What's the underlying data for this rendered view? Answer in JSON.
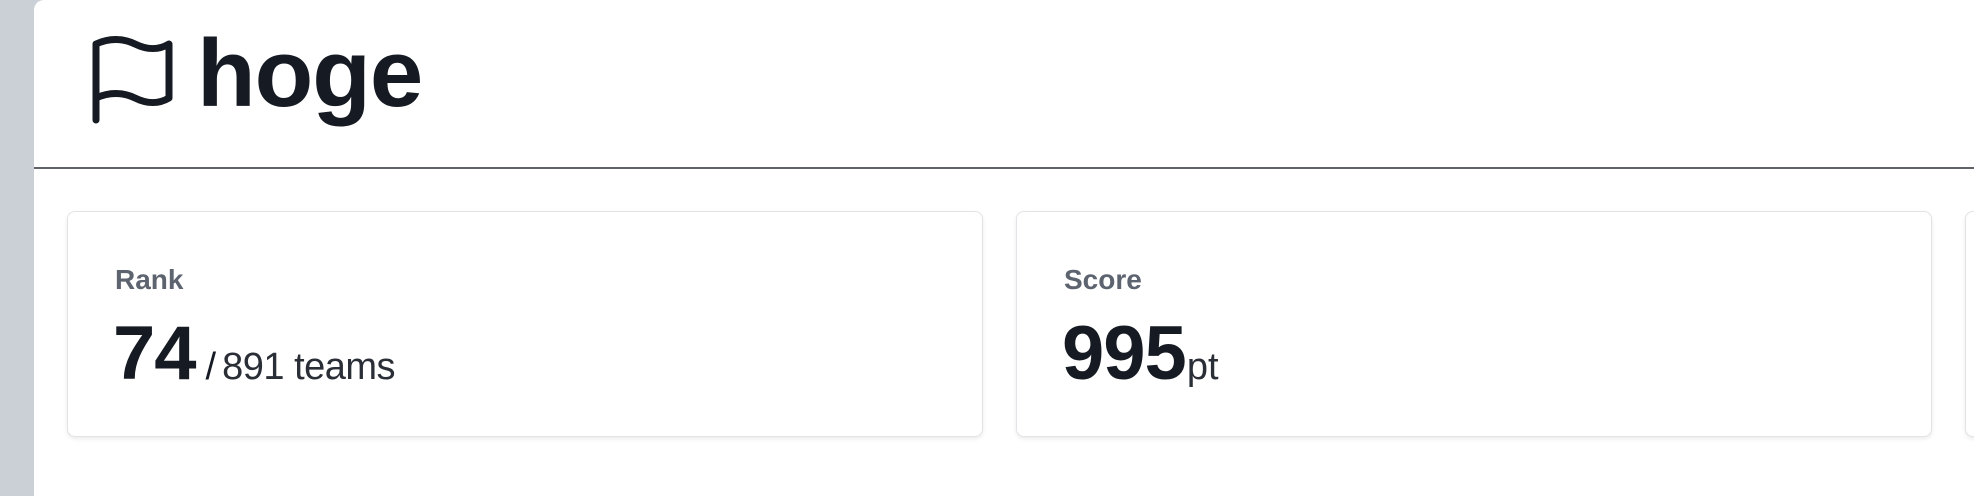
{
  "header": {
    "icon": "flag-icon",
    "team_name": "hoge"
  },
  "cards": {
    "rank": {
      "label": "Rank",
      "value": "74",
      "separator": "/",
      "total": "891 teams"
    },
    "score": {
      "label": "Score",
      "value": "995",
      "unit": "pt"
    }
  },
  "colors": {
    "background": "#cbd0d6",
    "text_dark": "#161a23",
    "label_gray": "#5d6470",
    "divider": "#5f6368"
  }
}
